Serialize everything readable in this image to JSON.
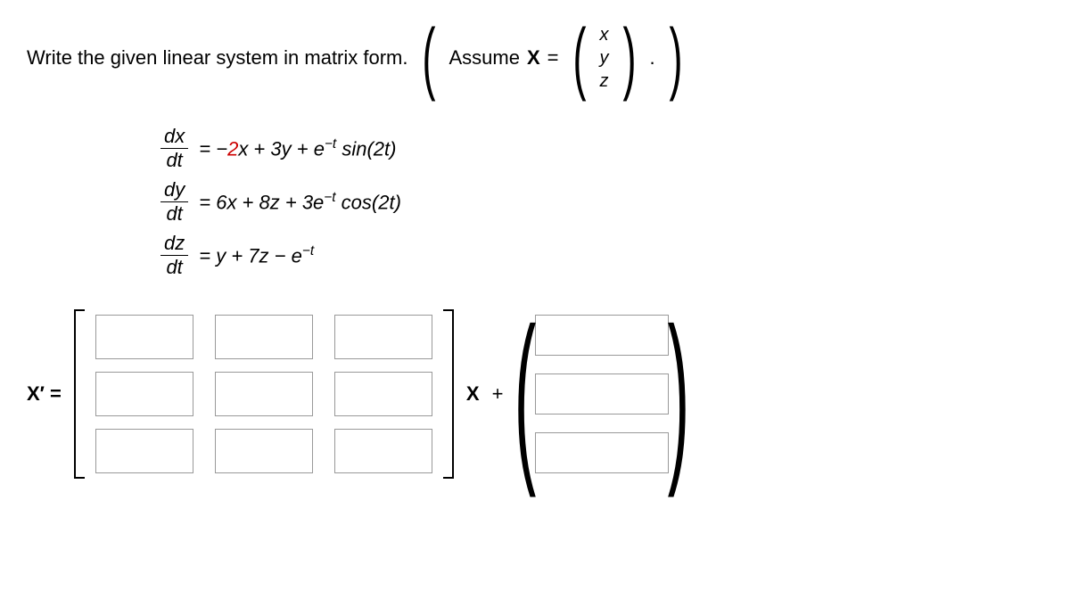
{
  "prompt": {
    "text": "Write the given linear system in matrix form.",
    "assume_pre": "Assume ",
    "X": "X",
    "equals": " = ",
    "vec": {
      "a": "x",
      "b": "y",
      "c": "z"
    },
    "period": "."
  },
  "equations": {
    "eq1": {
      "lhs_num": "dx",
      "lhs_den": "dt",
      "rhs_pre": "= −",
      "rhs_coef1": "2",
      "rhs_mid1": "x + 3y + e",
      "rhs_sup1": "−t",
      "rhs_mid2": " sin(2t)"
    },
    "eq2": {
      "lhs_num": "dy",
      "lhs_den": "dt",
      "rhs_pre": "= 6x + 8z + 3e",
      "rhs_sup": "−t",
      "rhs_post": " cos(2t)"
    },
    "eq3": {
      "lhs_num": "dz",
      "lhs_den": "dt",
      "rhs_pre": "= y + 7z − e",
      "rhs_sup": "−t"
    }
  },
  "answer": {
    "xprime": "X′ =",
    "X_between": "X",
    "plus": "+"
  },
  "chart_data": {
    "type": "table",
    "note": "3x3 coefficient matrix input grid plus 3x1 forcing-vector input column; all cells blank",
    "matrix_rows": 3,
    "matrix_cols": 3,
    "vector_rows": 3
  }
}
